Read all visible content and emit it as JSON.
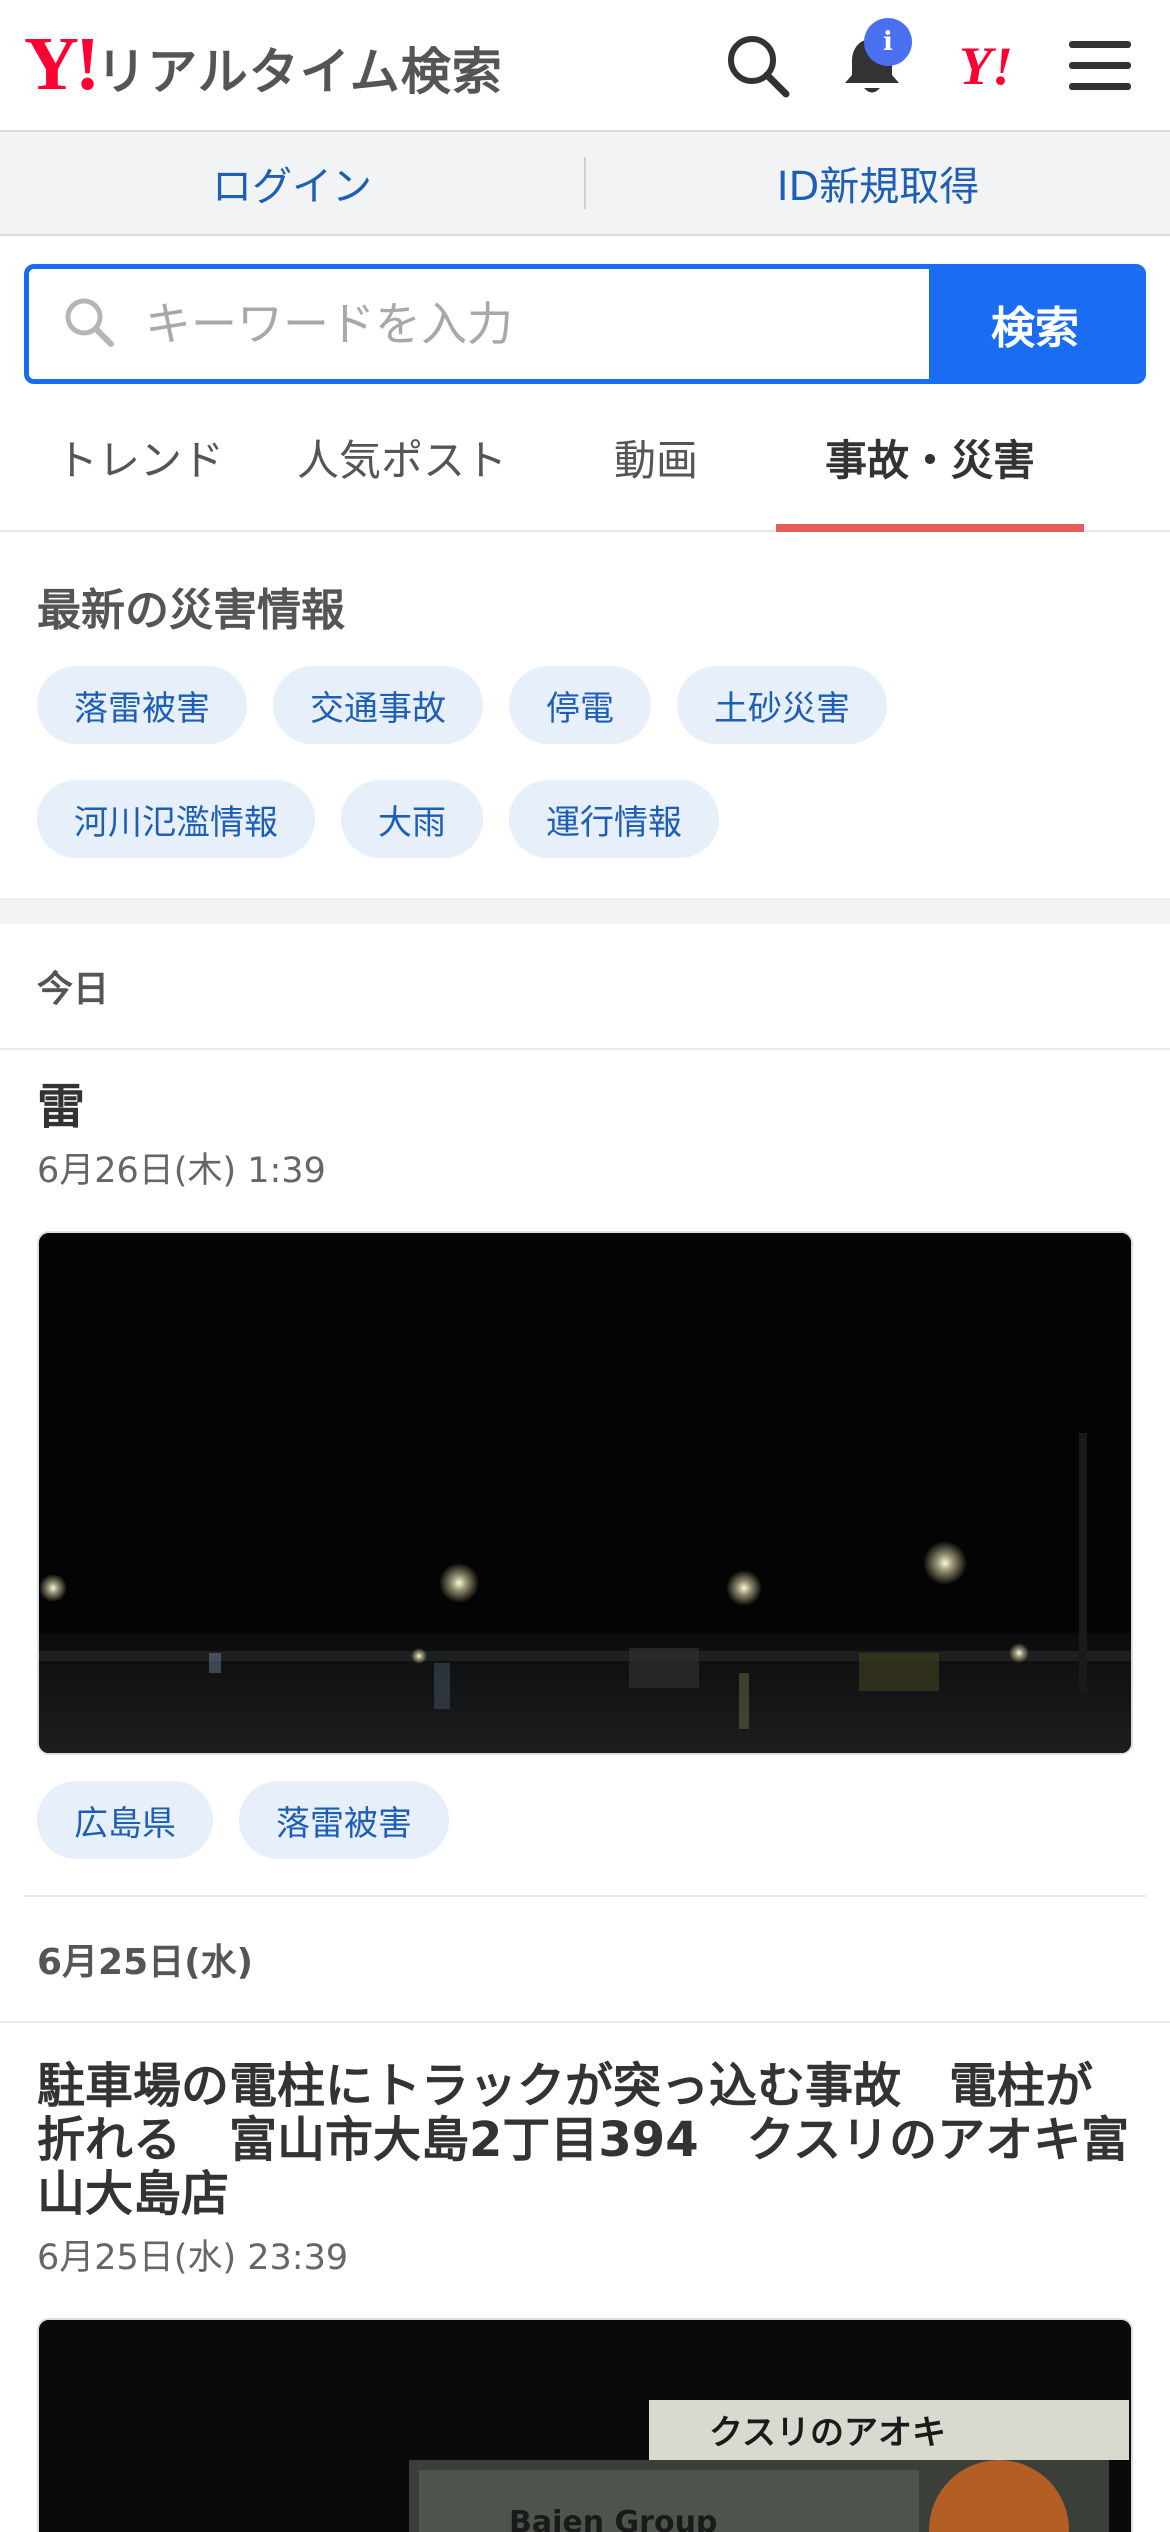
{
  "header": {
    "logo_mark": "Y!",
    "logo_text": "リアルタイム検索",
    "notification_badge": "i",
    "yahoo_mark": "Y!"
  },
  "loginbar": {
    "login": "ログイン",
    "register": "ID新規取得"
  },
  "search": {
    "placeholder": "キーワードを入力",
    "button": "検索"
  },
  "tabs": [
    {
      "label": "トレンド",
      "active": false
    },
    {
      "label": "人気ポスト",
      "active": false
    },
    {
      "label": "動画",
      "active": false
    },
    {
      "label": "事故・災害",
      "active": true
    }
  ],
  "disaster": {
    "title": "最新の災害情報",
    "chips": [
      "落雷被害",
      "交通事故",
      "停電",
      "土砂災害",
      "河川氾濫情報",
      "大雨",
      "運行情報"
    ]
  },
  "feed": [
    {
      "date_heading": "今日",
      "posts": [
        {
          "title": "雷",
          "time": "6月26日(木) 1:39",
          "chips": [
            "広島県",
            "落雷被害"
          ]
        }
      ]
    },
    {
      "date_heading": "6月25日(水)",
      "posts": [
        {
          "title": "駐車場の電柱にトラックが突っ込む事故　電柱が折れる　富山市大島2丁目394　クスリのアオキ富山大島店",
          "time": "6月25日(水) 23:39",
          "image_texts": [
            "クスリのアオキ",
            "Bajen Group"
          ]
        }
      ]
    }
  ],
  "colors": {
    "brand_red": "#ff0033",
    "link_blue": "#1d5fb5",
    "search_blue": "#1a6df2",
    "tab_underline": "#e85c58",
    "chip_bg": "#e7effa",
    "badge_blue": "#4a6ff0"
  },
  "icons": [
    "search-icon",
    "bell-icon",
    "yahoo-logo-icon",
    "menu-icon"
  ]
}
